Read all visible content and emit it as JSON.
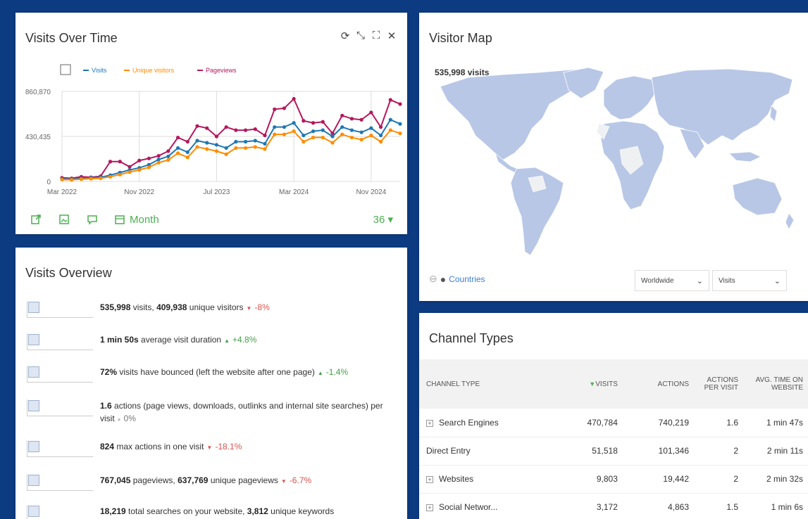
{
  "visits_over_time": {
    "title": "Visits Over Time",
    "actions": [
      "refresh-icon",
      "minimize-icon",
      "maximize-icon",
      "close-icon"
    ],
    "period_label": "Month",
    "limit_label": "36",
    "chart_data": {
      "type": "line",
      "x": [
        "Mar 2022",
        "Apr 2022",
        "May 2022",
        "Jun 2022",
        "Jul 2022",
        "Aug 2022",
        "Sep 2022",
        "Oct 2022",
        "Nov 2022",
        "Dec 2022",
        "Jan 2023",
        "Feb 2023",
        "Mar 2023",
        "Apr 2023",
        "May 2023",
        "Jun 2023",
        "Jul 2023",
        "Aug 2023",
        "Sep 2023",
        "Oct 2023",
        "Nov 2023",
        "Dec 2023",
        "Jan 2024",
        "Feb 2024",
        "Mar 2024",
        "Apr 2024",
        "May 2024",
        "Jun 2024",
        "Jul 2024",
        "Aug 2024",
        "Sep 2024",
        "Oct 2024",
        "Nov 2024",
        "Dec 2024",
        "Jan 2025",
        "Feb 2025"
      ],
      "tick_labels": [
        "Mar 2022",
        "Nov 2022",
        "Jul 2023",
        "Mar 2024",
        "Nov 2024"
      ],
      "y_ticks": [
        "860,870",
        "430,435",
        "0"
      ],
      "ylim": [
        0,
        860870
      ],
      "grid": true,
      "legend_position": "top",
      "series": [
        {
          "name": "Visits",
          "color": "#1f77b4",
          "values": [
            25000,
            22000,
            30000,
            35000,
            40000,
            60000,
            85000,
            110000,
            130000,
            160000,
            210000,
            240000,
            320000,
            280000,
            390000,
            370000,
            350000,
            320000,
            380000,
            380000,
            390000,
            360000,
            520000,
            520000,
            560000,
            440000,
            480000,
            490000,
            430000,
            520000,
            490000,
            470000,
            510000,
            440000,
            590000,
            550000
          ]
        },
        {
          "name": "Unique visitors",
          "color": "#ff8c00",
          "values": [
            18000,
            16000,
            22000,
            26000,
            30000,
            45000,
            65000,
            90000,
            110000,
            135000,
            180000,
            205000,
            270000,
            230000,
            330000,
            310000,
            290000,
            260000,
            320000,
            320000,
            330000,
            310000,
            450000,
            450000,
            480000,
            380000,
            420000,
            420000,
            370000,
            450000,
            420000,
            400000,
            440000,
            380000,
            490000,
            460000
          ]
        },
        {
          "name": "Pageviews",
          "color": "#b5175c",
          "values": [
            35000,
            30000,
            45000,
            40000,
            50000,
            190000,
            190000,
            140000,
            200000,
            220000,
            245000,
            290000,
            420000,
            380000,
            530000,
            510000,
            430000,
            520000,
            490000,
            490000,
            500000,
            440000,
            690000,
            700000,
            790000,
            580000,
            560000,
            570000,
            460000,
            630000,
            600000,
            590000,
            660000,
            520000,
            780000,
            740000
          ]
        }
      ]
    }
  },
  "visits_overview": {
    "title": "Visits Overview",
    "rows": [
      {
        "v1": "535,998",
        "t1": " visits, ",
        "v2": "409,938",
        "t2": " unique visitors",
        "delta": "-8%",
        "trend": "neg"
      },
      {
        "v1": "1 min 50s",
        "t1": " average visit duration",
        "v2": "",
        "t2": "",
        "delta": "+4.8%",
        "trend": "pos"
      },
      {
        "v1": "72%",
        "t1": " visits have bounced (left the website after one page)",
        "v2": "",
        "t2": "",
        "delta": "-1.4%",
        "trend": "pos"
      },
      {
        "v1": "1.6",
        "t1": " actions (page views, downloads, outlinks and internal site searches) per visit",
        "v2": "",
        "t2": "",
        "delta": "0%",
        "trend": "zero"
      },
      {
        "v1": "824",
        "t1": " max actions in one visit",
        "v2": "",
        "t2": "",
        "delta": "-18.1%",
        "trend": "neg"
      },
      {
        "v1": "767,045",
        "t1": " pageviews, ",
        "v2": "637,769",
        "t2": " unique pageviews",
        "delta": "-6.7%",
        "trend": "neg"
      },
      {
        "v1": "18,219",
        "t1": " total searches on your website, ",
        "v2": "3,812",
        "t2": " unique keywords",
        "delta": "",
        "trend": "none"
      }
    ]
  },
  "visitor_map": {
    "title": "Visitor Map",
    "visits_label": "535,998 visits",
    "countries_link": "Countries",
    "region_select": "Worldwide",
    "metric_select": "Visits"
  },
  "channel_types": {
    "title": "Channel Types",
    "headers": [
      "CHANNEL TYPE",
      "VISITS",
      "ACTIONS",
      "ACTIONS PER VISIT",
      "AVG. TIME ON WEBSITE"
    ],
    "rows": [
      {
        "name": "Search Engines",
        "expandable": true,
        "visits": "470,784",
        "actions": "740,219",
        "apv": "1.6",
        "avg": "1 min 47s"
      },
      {
        "name": "Direct Entry",
        "expandable": false,
        "visits": "51,518",
        "actions": "101,346",
        "apv": "2",
        "avg": "2 min 11s"
      },
      {
        "name": "Websites",
        "expandable": true,
        "visits": "9,803",
        "actions": "19,442",
        "apv": "2",
        "avg": "2 min 32s"
      },
      {
        "name": "Social Networ...",
        "expandable": true,
        "visits": "3,172",
        "actions": "4,863",
        "apv": "1.5",
        "avg": "1 min 6s"
      }
    ]
  },
  "colors": {
    "accent": "#4caf50",
    "frame": "#0d3b82",
    "map_land": "#b8c7e6"
  }
}
